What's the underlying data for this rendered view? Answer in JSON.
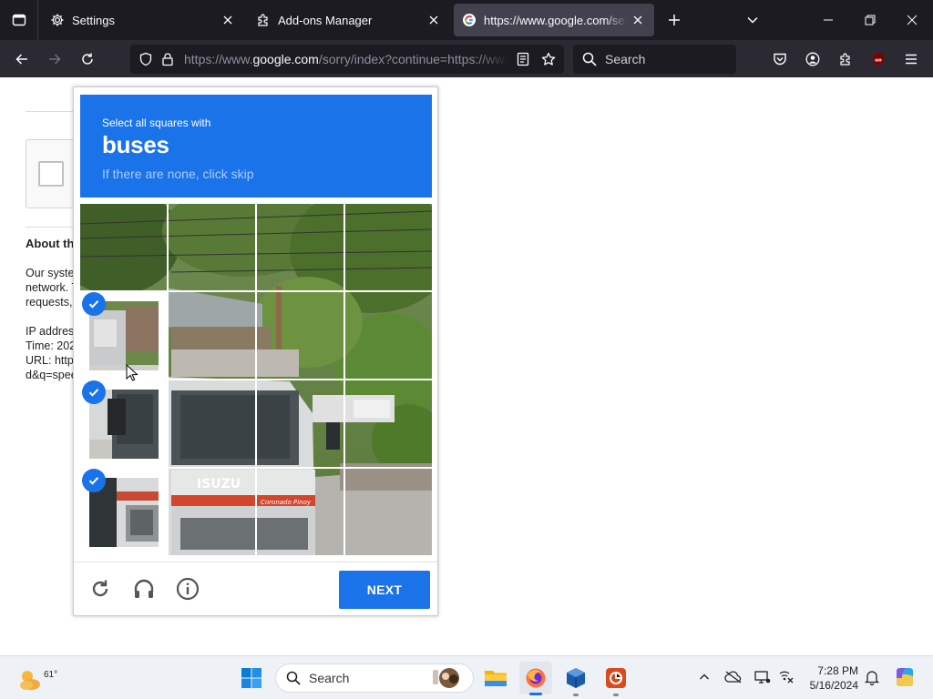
{
  "browser": {
    "tabs": [
      {
        "label": "Settings",
        "icon": "gear-icon",
        "active": false
      },
      {
        "label": "Add-ons Manager",
        "icon": "puzzle-icon",
        "active": false
      },
      {
        "label": "https://www.google.com/search",
        "icon": "google-icon",
        "active": true
      }
    ],
    "url": {
      "prefix": "https://www.",
      "domain": "google.com",
      "suffix": "/sorry/index?continue=https://www.google.com/search"
    },
    "search_placeholder": "Search"
  },
  "page": {
    "about_title": "About this page",
    "about_text": "Our systems have detected unusual traffic from your computer\nnetwork. This page checks to see if it's really you sending the\nrequests, and not a robot.\n\nIP address:\nTime: 2024\nURL: https://www.google.com/search\nd&q=speedtest"
  },
  "captcha": {
    "instruction": "Select all squares with",
    "target": "buses",
    "hint": "If there are none, click skip",
    "selected_tiles": [
      {
        "row": 2,
        "col": 1,
        "selected": true
      },
      {
        "row": 3,
        "col": 1,
        "selected": true
      },
      {
        "row": 4,
        "col": 1,
        "selected": true
      }
    ],
    "next_label": "NEXT",
    "truck_brand": "ISUZU",
    "truck_text": "Coronado Pinoy"
  },
  "taskbar": {
    "weather_temp": "61°",
    "search_placeholder": "Search",
    "time": "7:28 PM",
    "date": "5/16/2024"
  },
  "colors": {
    "accent": "#1a73e8",
    "chrome_dark": "#1c1b22",
    "toolbar": "#2b2a33"
  }
}
